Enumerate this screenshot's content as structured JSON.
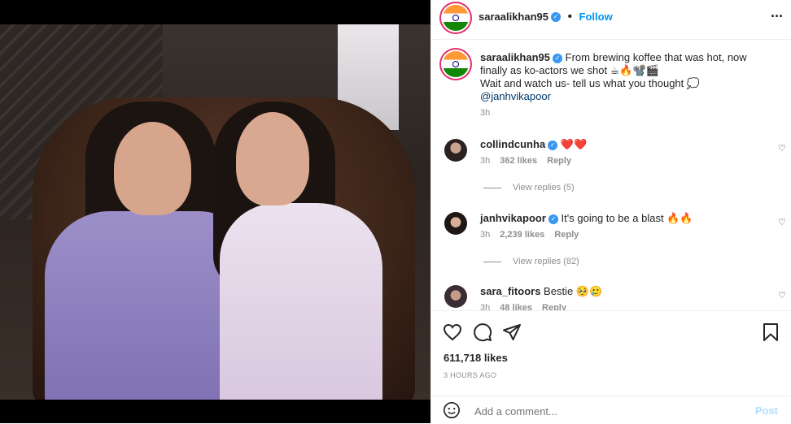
{
  "post": {
    "username": "saraalikhan95",
    "follow_label": "Follow",
    "caption_line1": "From brewing koffee that was hot, now finally as ko-actors we shot ☕🔥📽️🎬",
    "caption_line2": "Wait and watch us- tell us what you thought 💭",
    "mention": "@janhvikapoor",
    "caption_time": "3h",
    "likes": "611,718 likes",
    "timestamp": "3 HOURS AGO"
  },
  "comments": [
    {
      "user": "collindcunha",
      "text": "❤️❤️",
      "time": "3h",
      "likes": "362 likes",
      "reply": "Reply",
      "view_replies": "View replies (5)"
    },
    {
      "user": "janhvikapoor",
      "text": "It's going to be a blast 🔥🔥",
      "time": "3h",
      "likes": "2,239 likes",
      "reply": "Reply",
      "view_replies": "View replies (82)"
    },
    {
      "user": "sara_fitoors",
      "text": "Bestie 🥺🥲",
      "time": "3h",
      "likes": "48 likes",
      "reply": "Reply"
    }
  ],
  "add_comment": {
    "placeholder": "Add a comment...",
    "post_label": "Post"
  },
  "icons": [
    "more-icon",
    "heart-icon",
    "comment-icon",
    "share-icon",
    "save-icon",
    "emoji-icon",
    "verified-icon"
  ],
  "colors": {
    "link": "#0095f6",
    "verified": "#3897f0",
    "muted": "#8e8e8e",
    "post_disabled": "#b2dffc"
  }
}
